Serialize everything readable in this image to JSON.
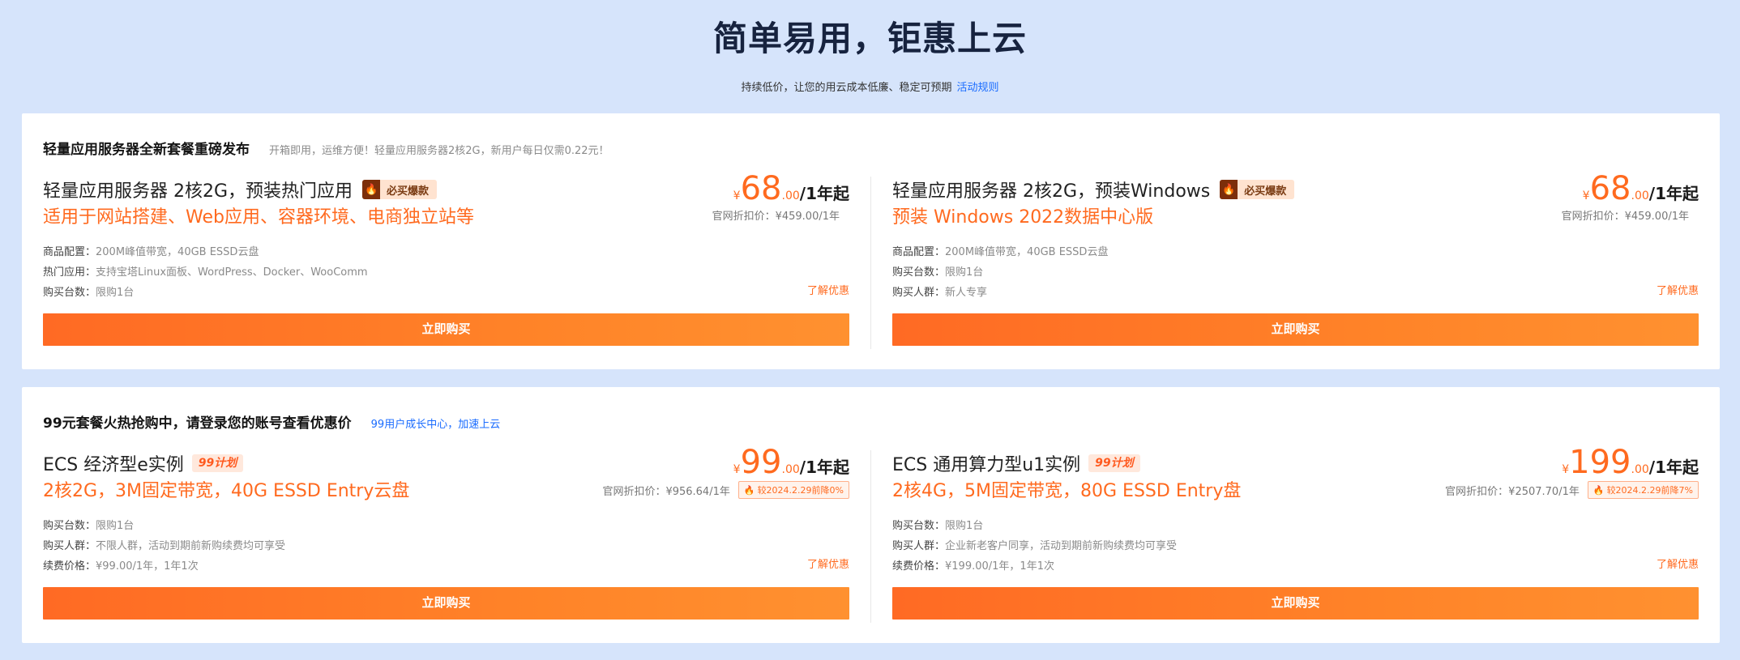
{
  "hero": {
    "title": "简单易用，钜惠上云",
    "subtitle": "持续低价，让您的用云成本低廉、稳定可预期",
    "link": "活动规则"
  },
  "panels": [
    {
      "title": "轻量应用服务器全新套餐重磅发布",
      "desc": "开箱即用，运维方便！轻量应用服务器2核2G，新用户每日仅需0.22元！",
      "cards": [
        {
          "name": "轻量应用服务器 2核2G，预装热门应用",
          "tag": "必买爆款",
          "subtitle": "适用于网站搭建、Web应用、容器环境、电商独立站等",
          "specs": [
            {
              "k": "商品配置：",
              "v": "200M峰值带宽，40GB ESSD云盘"
            },
            {
              "k": "热门应用：",
              "v": "支持宝塔Linux面板、WordPress、Docker、WooComm"
            },
            {
              "k": "购买台数：",
              "v": "限购1台"
            }
          ],
          "price": {
            "cur": "¥",
            "int": "68",
            "dec": ".00",
            "unit": "/1年起"
          },
          "orig": "官网折扣价：¥459.00/1年",
          "learn": "了解优惠",
          "buy": "立即购买"
        },
        {
          "name": "轻量应用服务器 2核2G，预装Windows",
          "tag": "必买爆款",
          "subtitle": "预装 Windows 2022数据中心版",
          "specs": [
            {
              "k": "商品配置：",
              "v": "200M峰值带宽，40GB ESSD云盘"
            },
            {
              "k": "购买台数：",
              "v": "限购1台"
            },
            {
              "k": "购买人群：",
              "v": "新人专享"
            }
          ],
          "price": {
            "cur": "¥",
            "int": "68",
            "dec": ".00",
            "unit": "/1年起"
          },
          "orig": "官网折扣价：¥459.00/1年",
          "learn": "了解优惠",
          "buy": "立即购买"
        }
      ]
    },
    {
      "title": "99元套餐火热抢购中，请登录您的账号查看优惠价",
      "desc": "99用户成长中心，加速上云",
      "cards": [
        {
          "name": "ECS 经济型e实例",
          "tag": "99计划",
          "subtitle": "2核2G，3M固定带宽，40G ESSD Entry云盘",
          "specs": [
            {
              "k": "购买台数：",
              "v": "限购1台"
            },
            {
              "k": "购买人群：",
              "v": "不限人群，活动到期前新购续费均可享受"
            },
            {
              "k": "续费价格：",
              "v": "¥99.00/1年，1年1次"
            }
          ],
          "price": {
            "cur": "¥",
            "int": "99",
            "dec": ".00",
            "unit": "/1年起"
          },
          "orig": "官网折扣价：¥956.64/1年",
          "drop": "较2024.2.29前降0%",
          "learn": "了解优惠",
          "buy": "立即购买"
        },
        {
          "name": "ECS 通用算力型u1实例",
          "tag": "99计划",
          "subtitle": "2核4G，5M固定带宽，80G ESSD Entry盘",
          "specs": [
            {
              "k": "购买台数：",
              "v": "限购1台"
            },
            {
              "k": "购买人群：",
              "v": "企业新老客户同享，活动到期前新购续费均可享受"
            },
            {
              "k": "续费价格：",
              "v": "¥199.00/1年，1年1次"
            }
          ],
          "price": {
            "cur": "¥",
            "int": "199",
            "dec": ".00",
            "unit": "/1年起"
          },
          "orig": "官网折扣价：¥2507.70/1年",
          "drop": "较2024.2.29前降7%",
          "learn": "了解优惠",
          "buy": "立即购买"
        }
      ]
    }
  ],
  "icons": {
    "hot_tag": "fire-icon",
    "drop_tag": "price-drop-icon"
  },
  "colors": {
    "accent": "#ff6a1f",
    "link": "#1a6cff",
    "background": "#d6e4fb"
  }
}
